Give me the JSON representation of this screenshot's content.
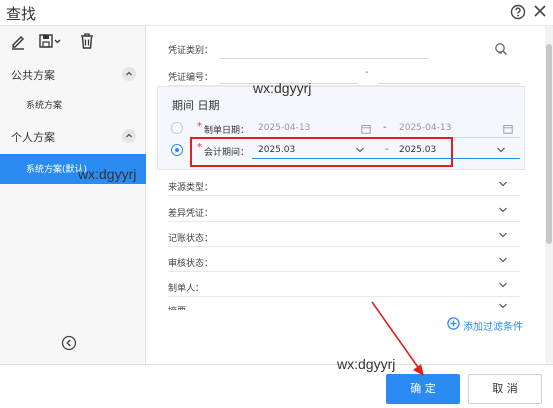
{
  "window": {
    "title": "查找"
  },
  "sidebar": {
    "public_section": "公共方案",
    "public_items": [
      "系统方案"
    ],
    "personal_section": "个人方案",
    "personal_items": [
      "系统方案(默认)"
    ]
  },
  "filters": {
    "voucher_type": {
      "label": "凭证类别：",
      "value": ""
    },
    "voucher_no": {
      "label": "凭证编号：",
      "separator": "-"
    },
    "period": {
      "title": "期间 日期",
      "make_date": {
        "label": "制单日期：",
        "from": "2025-04-13",
        "separator": "-",
        "to": "2025-04-13"
      },
      "acct_period": {
        "label": "会计期间：",
        "from": "2025.03",
        "separator": "-",
        "to": "2025.03"
      }
    },
    "rows": [
      {
        "label": "来源类型："
      },
      {
        "label": "差异凭证："
      },
      {
        "label": "记账状态："
      },
      {
        "label": "审核状态："
      },
      {
        "label": "制单人："
      },
      {
        "label": "摘要"
      }
    ],
    "add_filter": "添加过滤条件"
  },
  "watermarks": [
    "wx:dgyyrj",
    "wx:dgyyrj",
    "wx:dgyyrj"
  ],
  "footer": {
    "ok": "确 定",
    "cancel": "取 消"
  },
  "colors": {
    "accent": "#2a8cf2",
    "annotation": "#e02020"
  }
}
